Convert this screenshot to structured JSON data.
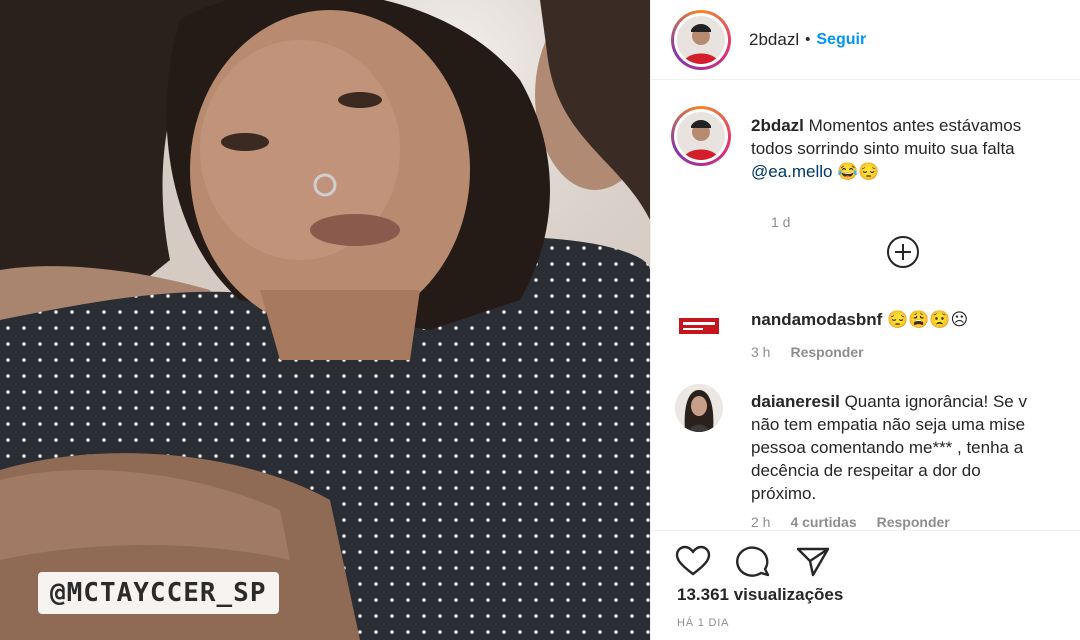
{
  "video": {
    "sticker_text": "@MCTAYCCER_SP"
  },
  "post": {
    "username": "2bdazl",
    "separator": "•",
    "follow_label": "Seguir"
  },
  "caption": {
    "username": "2bdazl",
    "line1": "Momentos antes estávamos",
    "line2": "todos sorrindo sinto muito sua falta",
    "mention": "@ea.mello",
    "emojis": "😂😔",
    "time": "1 d"
  },
  "comments": [
    {
      "username": "nandamodasbnf",
      "text": "😔😩😟☹",
      "time": "3 h",
      "reply_label": "Responder"
    },
    {
      "username": "daianeresil",
      "text_line1": "Quanta ignorância! Se v",
      "text_rest": "não tem empatia não seja uma mise\npessoa comentando me*** , tenha a\ndecência de respeitar a dor do\npróximo.",
      "time": "2 h",
      "likes": "4 curtidas",
      "reply_label": "Responder"
    }
  ],
  "actions": {
    "views": "13.361 visualizações",
    "posted_ago": "HÁ 1 DIA",
    "icons": [
      "heart-icon",
      "comment-icon",
      "share-icon"
    ]
  },
  "colors": {
    "follow_blue": "#0095f6",
    "mention": "#00376b",
    "muted": "#8e8e8e"
  }
}
